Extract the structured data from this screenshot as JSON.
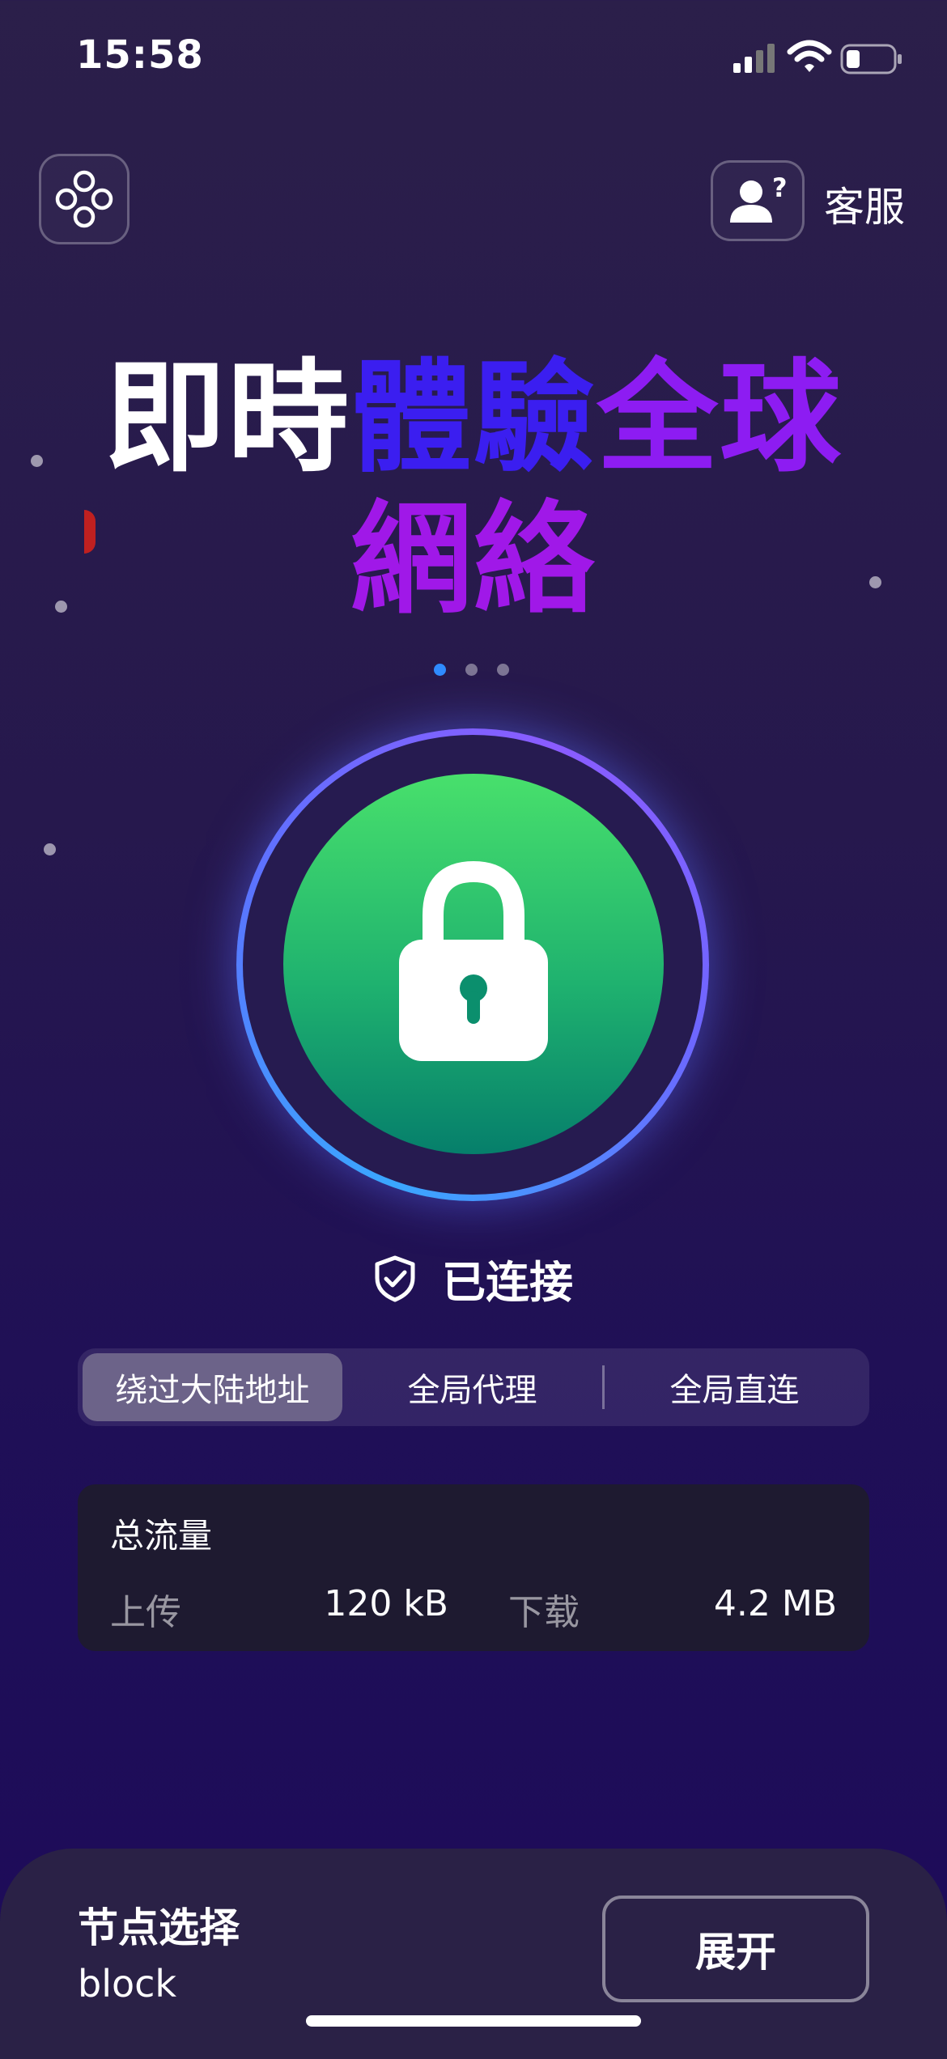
{
  "status_bar": {
    "time": "15:58"
  },
  "header": {
    "support_label": "客服"
  },
  "hero": {
    "part1": "即時",
    "part2": "體驗",
    "part3": "全球",
    "part4": "網絡"
  },
  "connection": {
    "status": "已连接"
  },
  "modes": {
    "items": [
      "绕过大陆地址",
      "全局代理",
      "全局直连"
    ],
    "selected": "绕过大陆地址"
  },
  "traffic": {
    "title": "总流量",
    "upload_label": "上传",
    "upload_value": "120 kB",
    "download_label": "下载",
    "download_value": "4.2 MB"
  },
  "node": {
    "title": "节点选择",
    "value": "block",
    "expand_label": "展开"
  },
  "colors": {
    "accent_green": "#2ecf6c",
    "pager_active": "#2f8bff",
    "hero_blue": "#3b1ef0",
    "hero_purple": "#8d1cf2"
  }
}
